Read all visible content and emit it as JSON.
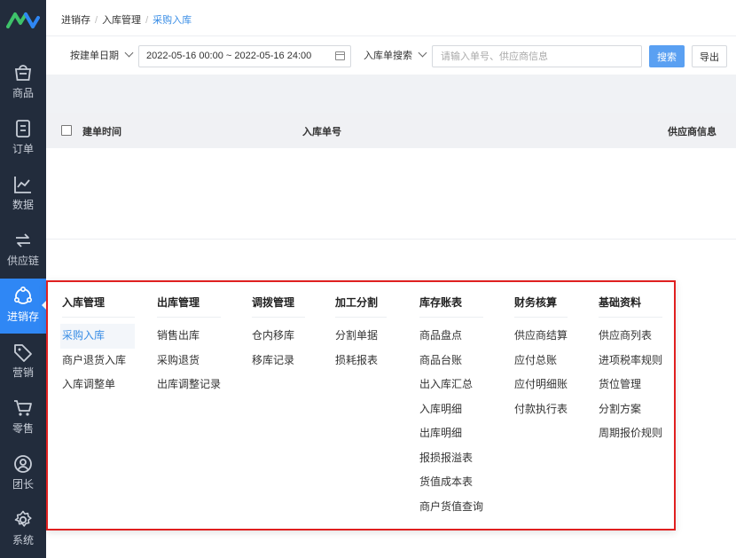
{
  "sidebar": {
    "items": [
      {
        "label": "商品",
        "icon": "basket-icon",
        "active": false
      },
      {
        "label": "订单",
        "icon": "order-icon",
        "active": false
      },
      {
        "label": "数据",
        "icon": "chart-line-icon",
        "active": false
      },
      {
        "label": "供应链",
        "icon": "exchange-icon",
        "active": false
      },
      {
        "label": "进销存",
        "icon": "cube-icon",
        "active": true
      },
      {
        "label": "营销",
        "icon": "tag-icon",
        "active": false
      },
      {
        "label": "零售",
        "icon": "cart-icon",
        "active": false
      },
      {
        "label": "团长",
        "icon": "user-icon",
        "active": false
      },
      {
        "label": "系统",
        "icon": "gear-icon",
        "active": false
      }
    ]
  },
  "breadcrumb": {
    "level1": "进销存",
    "level2": "入库管理",
    "current": "采购入库",
    "separator": "/"
  },
  "filters": {
    "date_type": "按建单日期",
    "date_range": "2022-05-16 00:00 ~ 2022-05-16 24:00",
    "search_type": "入库单搜索",
    "search_placeholder": "请输入单号、供应商信息",
    "search_button": "搜索",
    "export_button": "导出"
  },
  "table": {
    "columns": [
      "建单时间",
      "入库单号",
      "供应商信息"
    ]
  },
  "flyout": {
    "columns": [
      {
        "title": "入库管理",
        "items": [
          "采购入库",
          "商户退货入库",
          "入库调整单"
        ],
        "selected": 0
      },
      {
        "title": "出库管理",
        "items": [
          "销售出库",
          "采购退货",
          "出库调整记录"
        ]
      },
      {
        "title": "调拨管理",
        "items": [
          "仓内移库",
          "移库记录"
        ]
      },
      {
        "title": "加工分割",
        "items": [
          "分割单据",
          "损耗报表"
        ]
      },
      {
        "title": "库存账表",
        "items": [
          "商品盘点",
          "商品台账",
          "出入库汇总",
          "入库明细",
          "出库明细",
          "报损报溢表",
          "货值成本表",
          "商户货值查询"
        ]
      },
      {
        "title": "财务核算",
        "items": [
          "供应商结算",
          "应付总账",
          "应付明细账",
          "付款执行表"
        ]
      },
      {
        "title": "基础资料",
        "items": [
          "供应商列表",
          "进项税率规则",
          "货位管理",
          "分割方案",
          "周期报价规则"
        ]
      }
    ]
  },
  "colors": {
    "sidebar_bg": "#222c3c",
    "accent": "#2f87f5",
    "highlight_border": "#e02020"
  }
}
